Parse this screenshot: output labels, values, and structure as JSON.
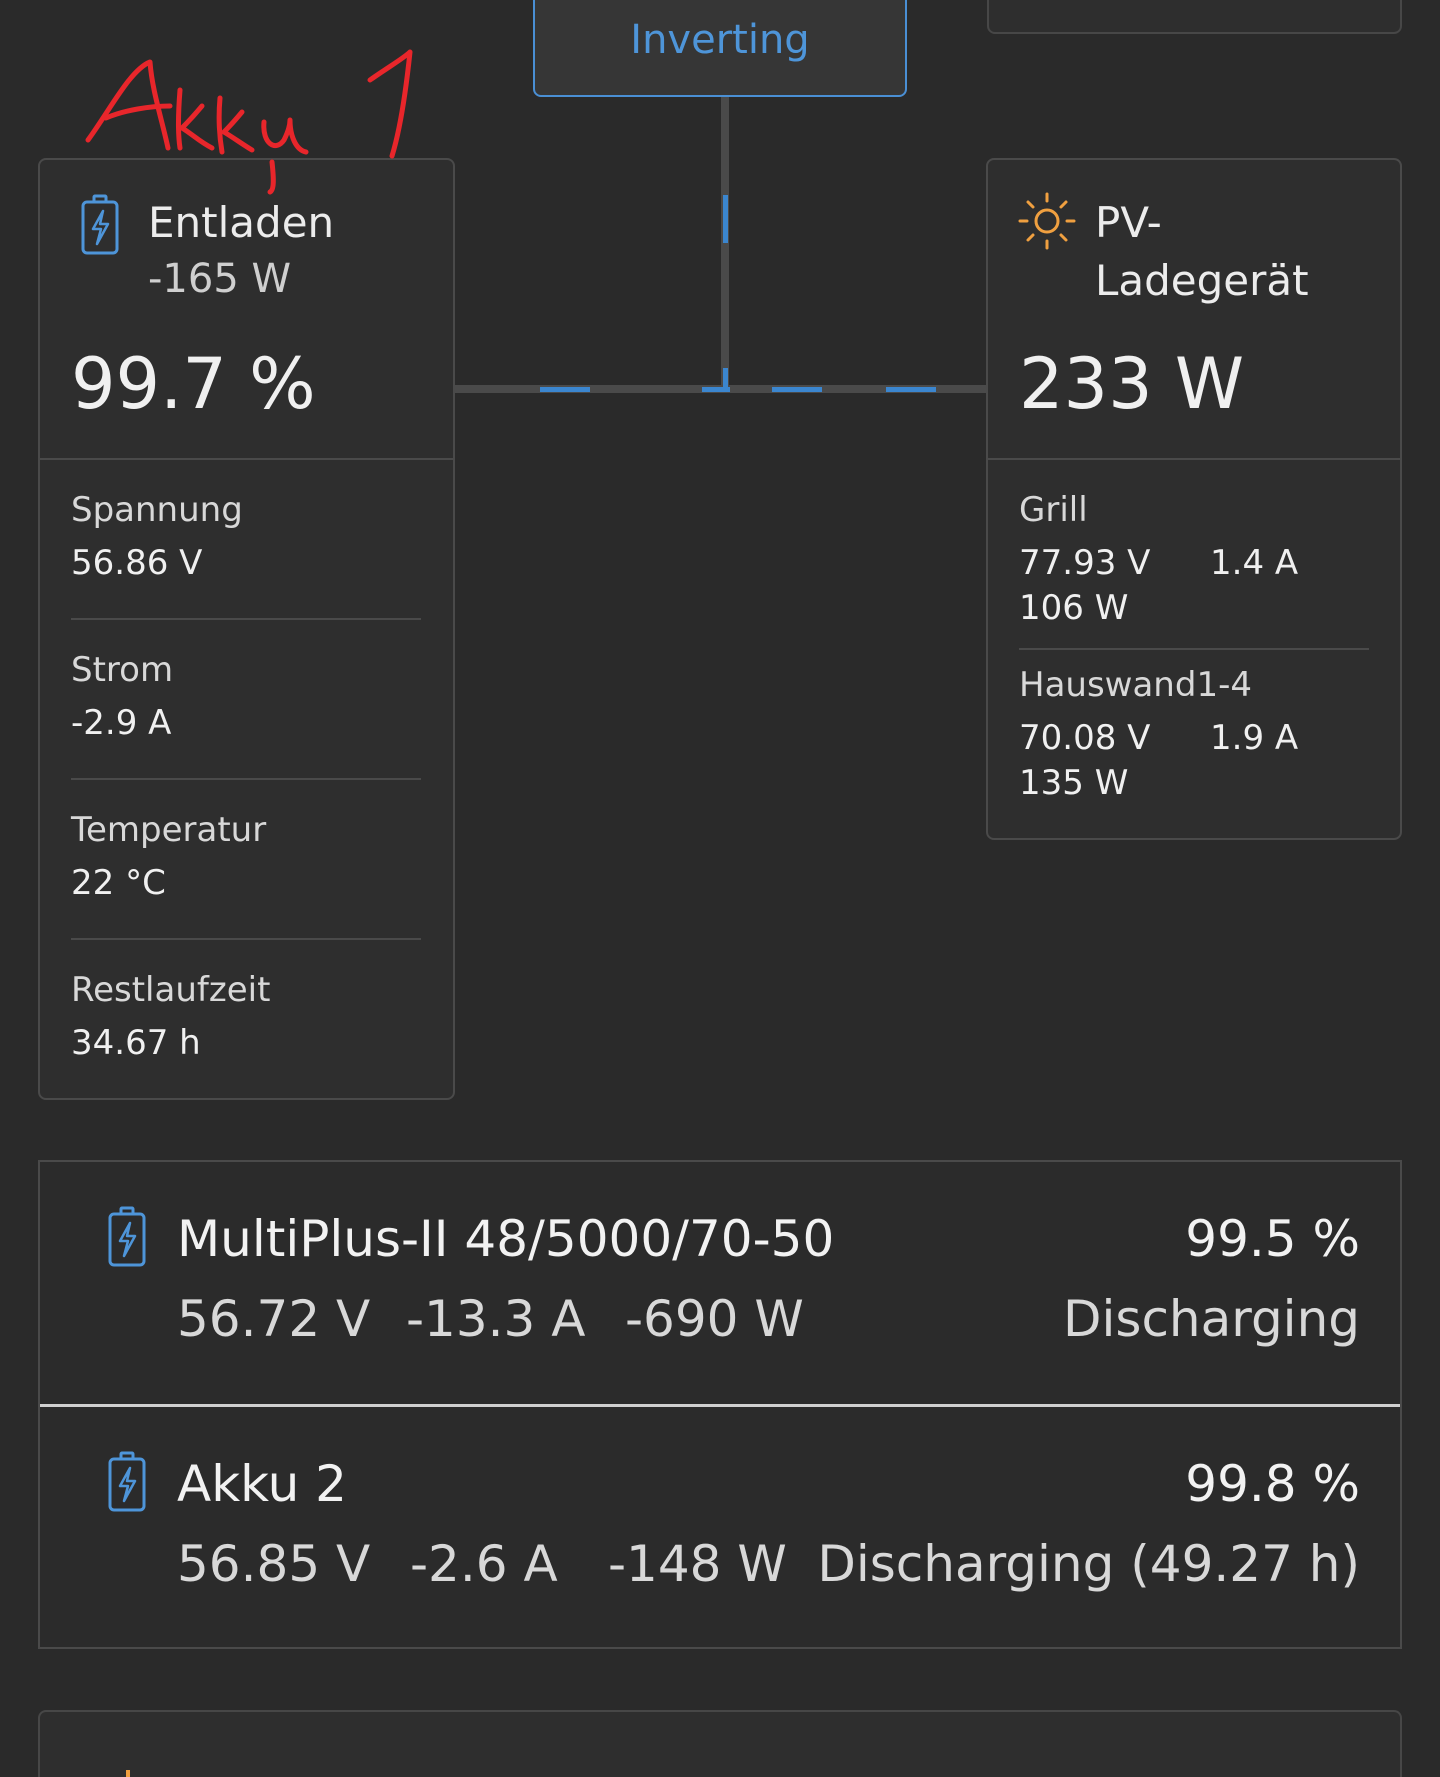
{
  "inverter": {
    "status": "Inverting"
  },
  "battery": {
    "state": "Entladen",
    "power": "-165 W",
    "soc": "99.7 %",
    "properties": [
      {
        "label": "Spannung",
        "value": "56.86 V"
      },
      {
        "label": "Strom",
        "value": "-2.9 A"
      },
      {
        "label": "Temperatur",
        "value": "22 °C"
      },
      {
        "label": "Restlaufzeit",
        "value": "34.67 h"
      }
    ],
    "icon": "battery-charging-icon"
  },
  "pv": {
    "title_line1": "PV-",
    "title_line2": "Ladegerät",
    "power": "233 W",
    "icon": "sun-icon",
    "trackers": [
      {
        "name": "Grill",
        "voltage": "77.93 V",
        "current": "1.4 A",
        "power": "106 W"
      },
      {
        "name": "Hauswand1-4",
        "voltage": "70.08 V",
        "current": "1.9 A",
        "power": "135 W"
      }
    ]
  },
  "devices": [
    {
      "name": "MultiPlus-II 48/5000/70-50",
      "soc": "99.5 %",
      "voltage": "56.72 V",
      "current": "-13.3 A",
      "power": "-690 W",
      "status": "Discharging"
    },
    {
      "name": "Akku 2",
      "soc": "99.8 %",
      "voltage": "56.85 V",
      "current": "-2.6 A",
      "power": "-148 W",
      "status": "Discharging (49.27 h)"
    }
  ],
  "annotation": {
    "text": "Akku 1",
    "color": "#e8262b"
  },
  "colors": {
    "accent": "#4e95d9",
    "background": "#2a2a2a",
    "sun": "#f0a040"
  }
}
